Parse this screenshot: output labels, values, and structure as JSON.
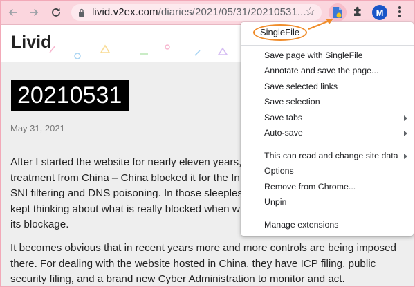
{
  "browser": {
    "url_host": "livid.v2ex.com",
    "url_path": "/diaries/2021/05/31/20210531....",
    "avatar_letter": "M"
  },
  "page": {
    "site_title": "Livid",
    "post_title": "20210531",
    "post_date": "May 31, 2021",
    "paragraph1_lines": [
      "After I started the website for nearly eleven years,",
      "treatment from China – China blocked it for the In",
      "SNI filtering and DNS poisoning. In those sleepless",
      "kept thinking about what is really blocked when w",
      "its blockage."
    ],
    "paragraph2_lines": [
      "It becomes obvious that in recent years more and more controls are being imposed",
      "there. For dealing with the website hosted in China, they have ICP filing, public",
      "security filing, and a brand new Cyber Administration to monitor and act."
    ]
  },
  "menu": {
    "title": "SingleFile",
    "group1": [
      {
        "label": "Save page with SingleFile",
        "submenu": false
      },
      {
        "label": "Annotate and save the page...",
        "submenu": false
      },
      {
        "label": "Save selected links",
        "submenu": false
      },
      {
        "label": "Save selection",
        "submenu": false
      },
      {
        "label": "Save tabs",
        "submenu": true
      },
      {
        "label": "Auto-save",
        "submenu": true
      }
    ],
    "group2": [
      {
        "label": "This can read and change site data",
        "submenu": true
      },
      {
        "label": "Options",
        "submenu": false
      },
      {
        "label": "Remove from Chrome...",
        "submenu": false
      },
      {
        "label": "Unpin",
        "submenu": false
      }
    ],
    "group3": [
      {
        "label": "Manage extensions",
        "submenu": false
      }
    ]
  },
  "colors": {
    "toolbar": "#fbd6de",
    "highlight": "#f08c2a",
    "avatar": "#1a56c8"
  },
  "icons": [
    "back-arrow-icon",
    "forward-arrow-icon",
    "reload-icon",
    "lock-icon",
    "star-icon",
    "singlefile-extension-icon",
    "puzzle-icon",
    "kebab-menu-icon"
  ]
}
